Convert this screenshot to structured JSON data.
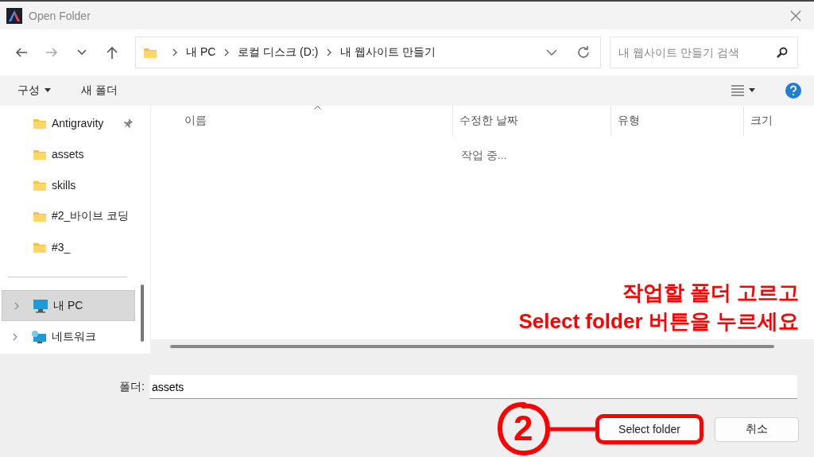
{
  "window": {
    "title": "Open Folder"
  },
  "address": {
    "segments": [
      "내 PC",
      "로컬 디스크 (D:)",
      "내 웹사이트 만들기"
    ]
  },
  "search": {
    "placeholder": "내 웹사이트 만들기 검색"
  },
  "toolbar": {
    "organize": "구성",
    "new_folder": "새 폴더"
  },
  "sidebar": {
    "items": [
      {
        "label": "Antigravity",
        "kind": "folder",
        "pinned": true,
        "selected": false
      },
      {
        "label": "assets",
        "kind": "folder",
        "pinned": false,
        "selected": false
      },
      {
        "label": "skills",
        "kind": "folder",
        "pinned": false,
        "selected": false
      },
      {
        "label": "#2_바이브 코딩",
        "kind": "folder",
        "pinned": false,
        "selected": false
      },
      {
        "label": "#3_",
        "kind": "folder",
        "pinned": false,
        "selected": false
      },
      {
        "label": "내 PC",
        "kind": "pc",
        "pinned": false,
        "selected": true
      },
      {
        "label": "네트워크",
        "kind": "network",
        "pinned": false,
        "selected": false
      }
    ]
  },
  "columns": [
    {
      "label": "이름",
      "sorted": true
    },
    {
      "label": "수정한 날짜",
      "sorted": false
    },
    {
      "label": "유형",
      "sorted": false
    },
    {
      "label": "크기",
      "sorted": false
    }
  ],
  "status_text": "작업 중...",
  "annotation": {
    "lines": [
      "작업할 폴더 고르고",
      "Select folder 버튼을 누르세요"
    ],
    "step": "2"
  },
  "folder_field": {
    "label": "폴더:",
    "value": "assets"
  },
  "buttons": [
    {
      "label": "Select folder",
      "kind": "primary"
    },
    {
      "label": "취소",
      "kind": "cancel"
    }
  ]
}
